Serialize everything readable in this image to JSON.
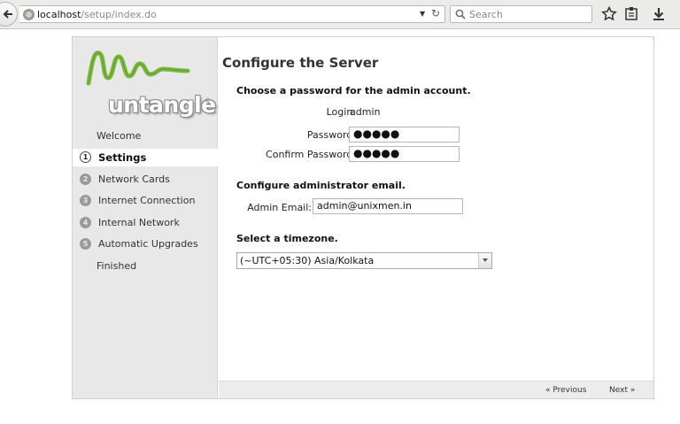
{
  "browser": {
    "url_host": "localhost",
    "url_path": "/setup/index.do",
    "search_placeholder": "Search"
  },
  "logo": {
    "text": "untangle",
    "reg": "®"
  },
  "steps": [
    {
      "label": "Welcome",
      "state": "done"
    },
    {
      "label": "Settings",
      "num": "1",
      "state": "current"
    },
    {
      "label": "Network Cards",
      "num": "2",
      "state": "todo"
    },
    {
      "label": "Internet Connection",
      "num": "3",
      "state": "todo"
    },
    {
      "label": "Internal Network",
      "num": "4",
      "state": "todo"
    },
    {
      "label": "Automatic Upgrades",
      "num": "5",
      "state": "todo"
    },
    {
      "label": "Finished",
      "state": "todo"
    }
  ],
  "main": {
    "title": "Configure the Server",
    "password_section": {
      "title": "Choose a password for the admin account.",
      "login_label": "Login:",
      "login_value": "admin",
      "password_label": "Password:",
      "password_value": "●●●●●",
      "confirm_label": "Confirm Password:",
      "confirm_value": "●●●●●"
    },
    "email_section": {
      "title": "Configure administrator email.",
      "email_label": "Admin Email:",
      "email_value": "admin@unixmen.in"
    },
    "timezone_section": {
      "title": "Select a timezone.",
      "selected": "(~UTC+05:30) Asia/Kolkata"
    }
  },
  "footer": {
    "previous": "« Previous",
    "next": "Next »"
  }
}
